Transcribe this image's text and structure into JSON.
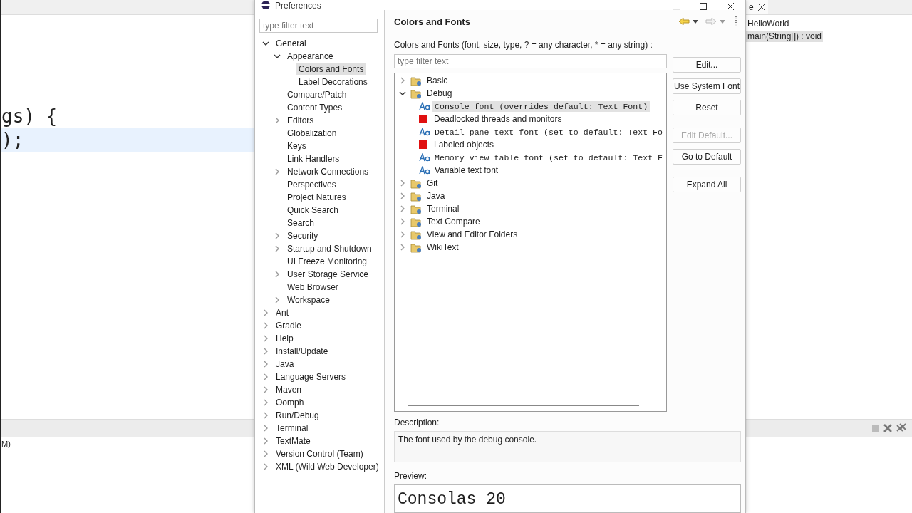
{
  "ide": {
    "code_lines": [
      {
        "text": "gs) {",
        "highlighted": false
      },
      {
        "text": ");",
        "highlighted": true
      }
    ],
    "console_text": "M)",
    "outline_tab": {
      "label": "e"
    },
    "outline_items": [
      {
        "label": "HelloWorld",
        "selected": false
      },
      {
        "label": "main(String[]) : void",
        "selected": true
      }
    ]
  },
  "dialog": {
    "title": "Preferences",
    "filter": {
      "placeholder": "type filter text"
    },
    "tree": [
      {
        "label": "General",
        "expanded": true,
        "selected": false,
        "children": [
          {
            "label": "Appearance",
            "expanded": true,
            "selected": false,
            "children": [
              {
                "label": "Colors and Fonts",
                "selected": true
              },
              {
                "label": "Label Decorations",
                "selected": false
              }
            ]
          },
          {
            "label": "Compare/Patch",
            "selected": false
          },
          {
            "label": "Content Types",
            "selected": false
          },
          {
            "label": "Editors",
            "expanded": false,
            "selected": false
          },
          {
            "label": "Globalization",
            "selected": false
          },
          {
            "label": "Keys",
            "selected": false
          },
          {
            "label": "Link Handlers",
            "selected": false
          },
          {
            "label": "Network Connections",
            "expanded": false,
            "selected": false
          },
          {
            "label": "Perspectives",
            "selected": false
          },
          {
            "label": "Project Natures",
            "selected": false
          },
          {
            "label": "Quick Search",
            "selected": false
          },
          {
            "label": "Search",
            "selected": false
          },
          {
            "label": "Security",
            "expanded": false,
            "selected": false
          },
          {
            "label": "Startup and Shutdown",
            "expanded": false,
            "selected": false
          },
          {
            "label": "UI Freeze Monitoring",
            "selected": false
          },
          {
            "label": "User Storage Service",
            "expanded": false,
            "selected": false
          },
          {
            "label": "Web Browser",
            "selected": false
          },
          {
            "label": "Workspace",
            "expanded": false,
            "selected": false
          }
        ]
      },
      {
        "label": "Ant",
        "expanded": false,
        "selected": false
      },
      {
        "label": "Gradle",
        "expanded": false,
        "selected": false
      },
      {
        "label": "Help",
        "expanded": false,
        "selected": false
      },
      {
        "label": "Install/Update",
        "expanded": false,
        "selected": false
      },
      {
        "label": "Java",
        "expanded": false,
        "selected": false
      },
      {
        "label": "Language Servers",
        "expanded": false,
        "selected": false
      },
      {
        "label": "Maven",
        "expanded": false,
        "selected": false
      },
      {
        "label": "Oomph",
        "expanded": false,
        "selected": false
      },
      {
        "label": "Run/Debug",
        "expanded": false,
        "selected": false
      },
      {
        "label": "Terminal",
        "expanded": false,
        "selected": false
      },
      {
        "label": "TextMate",
        "expanded": false,
        "selected": false
      },
      {
        "label": "Version Control (Team)",
        "expanded": false,
        "selected": false
      },
      {
        "label": "XML (Wild Web Developer)",
        "expanded": false,
        "selected": false
      }
    ],
    "page": {
      "title": "Colors and Fonts",
      "filter_label": "Colors and Fonts (font, size, type, ? = any character, * = any string) :",
      "filter": {
        "placeholder": "type filter text"
      },
      "items": [
        {
          "kind": "folder",
          "label": "Basic",
          "expanded": false,
          "selected": false
        },
        {
          "kind": "folder",
          "label": "Debug",
          "expanded": true,
          "selected": false,
          "children": [
            {
              "kind": "font",
              "label": "Console font (overrides default: Text Font)",
              "mono": true,
              "selected": true
            },
            {
              "kind": "color",
              "label": "Deadlocked threads and monitors",
              "color": "#e01010",
              "selected": false
            },
            {
              "kind": "font",
              "label": "Detail pane text font (set to default: Text Fo",
              "mono": true,
              "selected": false
            },
            {
              "kind": "color",
              "label": "Labeled objects",
              "color": "#e01010",
              "selected": false
            },
            {
              "kind": "font",
              "label": "Memory view table font (set to default: Text F",
              "mono": true,
              "selected": false
            },
            {
              "kind": "font",
              "label": "Variable text font",
              "mono": false,
              "selected": false
            }
          ]
        },
        {
          "kind": "folder",
          "label": "Git",
          "expanded": false,
          "selected": false
        },
        {
          "kind": "folder",
          "label": "Java",
          "expanded": false,
          "selected": false
        },
        {
          "kind": "folder",
          "label": "Terminal",
          "expanded": false,
          "selected": false
        },
        {
          "kind": "folder",
          "label": "Text Compare",
          "expanded": false,
          "selected": false
        },
        {
          "kind": "folder",
          "label": "View and Editor Folders",
          "expanded": false,
          "selected": false
        },
        {
          "kind": "folder",
          "label": "WikiText",
          "expanded": false,
          "selected": false
        }
      ],
      "button_groups": [
        [
          {
            "label": "Edit...",
            "disabled": false
          },
          {
            "label": "Use System Font",
            "disabled": false
          },
          {
            "label": "Reset",
            "disabled": false
          }
        ],
        [
          {
            "label": "Edit Default...",
            "disabled": true
          },
          {
            "label": "Go to Default",
            "disabled": false
          }
        ],
        [
          {
            "label": "Expand All",
            "disabled": false
          }
        ]
      ],
      "description_label": "Description:",
      "description": "The font used by the debug console.",
      "preview_label": "Preview:",
      "preview": "Consolas 20"
    }
  }
}
